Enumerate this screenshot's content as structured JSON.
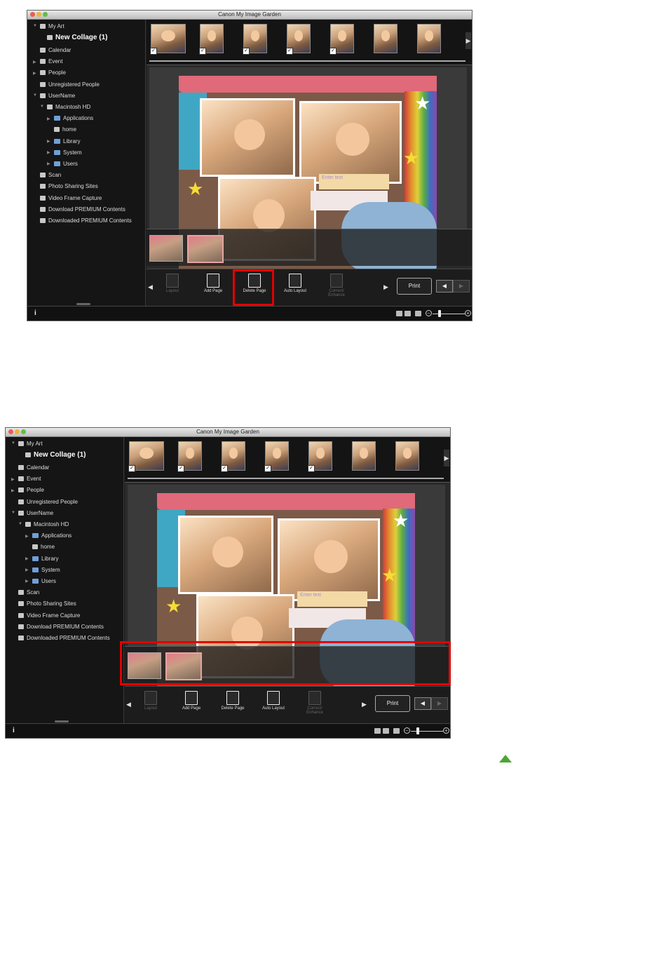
{
  "window_title": "Canon My Image Garden",
  "sidebar_items": [
    {
      "label": "My Art",
      "indent": 1,
      "arrow": "▼",
      "icon": "art-icon"
    },
    {
      "label": "New Collage (1)",
      "indent": 2,
      "bold": true,
      "icon": "collage-icon"
    },
    {
      "label": "Calendar",
      "indent": 1,
      "icon": "calendar-icon"
    },
    {
      "label": "Event",
      "indent": 1,
      "arrow": "▶",
      "icon": "event-icon"
    },
    {
      "label": "People",
      "indent": 1,
      "arrow": "▶",
      "icon": "person-icon"
    },
    {
      "label": "Unregistered People",
      "indent": 1,
      "icon": "unregistered-people-icon"
    },
    {
      "label": "UserName",
      "indent": 1,
      "arrow": "▼",
      "icon": "computer-icon"
    },
    {
      "label": "Macintosh HD",
      "indent": 2,
      "arrow": "▼",
      "icon": "drive-icon"
    },
    {
      "label": "Applications",
      "indent": 3,
      "arrow": "▶",
      "icon": "folder-icon"
    },
    {
      "label": "home",
      "indent": 3,
      "icon": "home-icon"
    },
    {
      "label": "Library",
      "indent": 3,
      "arrow": "▶",
      "icon": "folder-icon"
    },
    {
      "label": "System",
      "indent": 3,
      "arrow": "▶",
      "icon": "folder-icon"
    },
    {
      "label": "Users",
      "indent": 3,
      "arrow": "▶",
      "icon": "folder-icon"
    },
    {
      "label": "Scan",
      "indent": 1,
      "icon": "scan-icon"
    },
    {
      "label": "Photo Sharing Sites",
      "indent": 1,
      "icon": "photo-sharing-icon"
    },
    {
      "label": "Video Frame Capture",
      "indent": 1,
      "icon": "video-frame-icon"
    },
    {
      "label": "Download PREMIUM Contents",
      "indent": 1,
      "icon": "download-icon"
    },
    {
      "label": "Downloaded PREMIUM Contents",
      "indent": 1,
      "icon": "downloaded-folder-icon"
    }
  ],
  "collage": {
    "enter_text": "Enter text"
  },
  "toolbar": {
    "layout": "Layout",
    "add_page": "Add Page",
    "delete_page": "Delete Page",
    "auto_layout": "Auto Layout",
    "correct_enhance": "Correct/ Enhance",
    "print": "Print"
  },
  "status": {
    "info": "i"
  },
  "colors": {
    "highlight": "#e10000",
    "page_bg": "#ffffff",
    "up_arrow": "#4aa632"
  },
  "screens": [
    {
      "highlight": "delete-page-button"
    },
    {
      "highlight": "page-thumbnail-strip"
    }
  ]
}
